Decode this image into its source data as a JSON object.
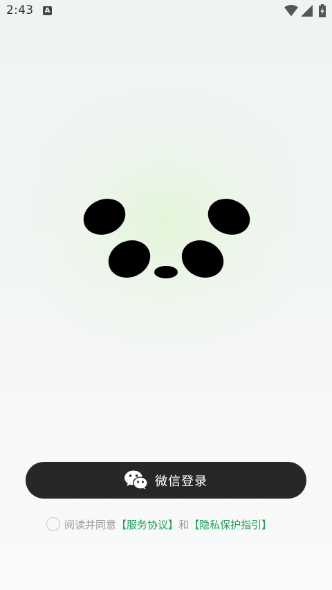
{
  "status_bar": {
    "time": "2:43",
    "notification_icon": "android-a-icon",
    "notification_glyph": "A",
    "wifi_icon": "wifi-icon",
    "signal_icon": "cell-signal-icon",
    "battery_icon": "battery-charging-icon"
  },
  "hero": {
    "image": "panda-face-logo",
    "color": "#000000"
  },
  "login": {
    "wechat_button_label": "微信登录",
    "wechat_icon": "wechat-icon",
    "button_color": "#272727"
  },
  "agreement": {
    "prefix": "阅读并同意",
    "terms_bracket_open": "【",
    "terms_link": "服务协议",
    "terms_bracket_close": "】",
    "conjunction": "和",
    "privacy_bracket_open": "【",
    "privacy_link": "隐私保护指引",
    "privacy_bracket_close": "】",
    "checked": false,
    "link_color": "#1f9f5a"
  }
}
